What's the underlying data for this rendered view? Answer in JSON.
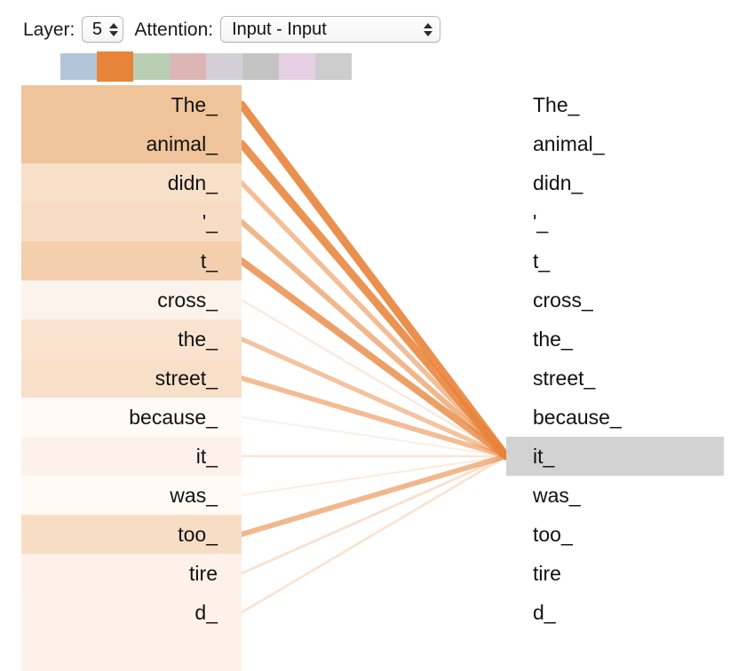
{
  "header": {
    "layer_label": "Layer:",
    "layer_value": "5",
    "attention_label": "Attention:",
    "attention_value": "Input - Input",
    "stepper_up_icon": "triangle-up-icon",
    "stepper_down_icon": "triangle-down-icon"
  },
  "head_swatches": [
    {
      "name": "head-1",
      "color": "#b3c6d9",
      "selected": false
    },
    {
      "name": "head-2",
      "color": "#e8833a",
      "selected": true
    },
    {
      "name": "head-3",
      "color": "#b9cfb4",
      "selected": false
    },
    {
      "name": "head-4",
      "color": "#dbb6b5",
      "selected": false
    },
    {
      "name": "head-5",
      "color": "#d3cfd9",
      "selected": false
    },
    {
      "name": "head-6",
      "color": "#c4c4c4",
      "selected": false
    },
    {
      "name": "head-7",
      "color": "#e5cfe2",
      "selected": false
    },
    {
      "name": "head-8",
      "color": "#cccccc",
      "selected": false
    }
  ],
  "chart_data": {
    "type": "heatmap",
    "title": "Attention: Input - Input",
    "layer": 5,
    "selected_head": 2,
    "selected_query_index": 9,
    "selected_query_token": "it_",
    "highlight_color": "#d2d2d2",
    "line_color": "#e8833a",
    "source_tokens": [
      "The_",
      "animal_",
      "didn_",
      "'_",
      "t_",
      "cross_",
      "the_",
      "street_",
      "because_",
      "it_",
      "was_",
      "too_",
      "tire",
      "d_"
    ],
    "target_tokens": [
      "The_",
      "animal_",
      "didn_",
      "'_",
      "t_",
      "cross_",
      "the_",
      "street_",
      "because_",
      "it_",
      "was_",
      "too_",
      "tire",
      "d_"
    ],
    "xlabel": "",
    "ylabel": "",
    "legend": "",
    "attention_weights": [
      {
        "token": "The_",
        "weight": 0.62,
        "cell_color": "#efc49a"
      },
      {
        "token": "animal_",
        "weight": 0.6,
        "cell_color": "#efc49a"
      },
      {
        "token": "didn_",
        "weight": 0.33,
        "cell_color": "#f8dfc8"
      },
      {
        "token": "'_",
        "weight": 0.38,
        "cell_color": "#f7dcc3"
      },
      {
        "token": "t_",
        "weight": 0.52,
        "cell_color": "#f3cfae"
      },
      {
        "token": "cross_",
        "weight": 0.07,
        "cell_color": "#fdf3ed"
      },
      {
        "token": "the_",
        "weight": 0.3,
        "cell_color": "#f9e3ce"
      },
      {
        "token": "street_",
        "weight": 0.34,
        "cell_color": "#f8dfc8"
      },
      {
        "token": "because_",
        "weight": 0.03,
        "cell_color": "#fefaf7"
      },
      {
        "token": "it_",
        "weight": 0.09,
        "cell_color": "#fdf2eb"
      },
      {
        "token": "was_",
        "weight": 0.05,
        "cell_color": "#fefaf6"
      },
      {
        "token": "too_",
        "weight": 0.37,
        "cell_color": "#f8ddc5"
      },
      {
        "token": "tire",
        "weight": 0.11,
        "cell_color": "#fdf1e9"
      },
      {
        "token": "d_",
        "weight": 0.1,
        "cell_color": "#fdf2ea"
      }
    ]
  }
}
